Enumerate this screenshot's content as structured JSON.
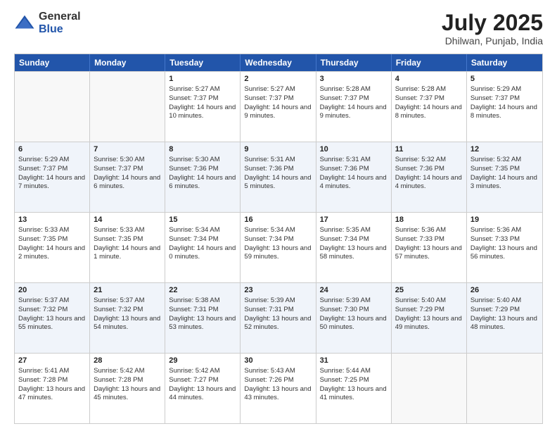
{
  "logo": {
    "general": "General",
    "blue": "Blue"
  },
  "header": {
    "month": "July 2025",
    "location": "Dhilwan, Punjab, India"
  },
  "weekdays": [
    "Sunday",
    "Monday",
    "Tuesday",
    "Wednesday",
    "Thursday",
    "Friday",
    "Saturday"
  ],
  "weeks": [
    [
      {
        "day": "",
        "sunrise": "",
        "sunset": "",
        "daylight": ""
      },
      {
        "day": "",
        "sunrise": "",
        "sunset": "",
        "daylight": ""
      },
      {
        "day": "1",
        "sunrise": "Sunrise: 5:27 AM",
        "sunset": "Sunset: 7:37 PM",
        "daylight": "Daylight: 14 hours and 10 minutes."
      },
      {
        "day": "2",
        "sunrise": "Sunrise: 5:27 AM",
        "sunset": "Sunset: 7:37 PM",
        "daylight": "Daylight: 14 hours and 9 minutes."
      },
      {
        "day": "3",
        "sunrise": "Sunrise: 5:28 AM",
        "sunset": "Sunset: 7:37 PM",
        "daylight": "Daylight: 14 hours and 9 minutes."
      },
      {
        "day": "4",
        "sunrise": "Sunrise: 5:28 AM",
        "sunset": "Sunset: 7:37 PM",
        "daylight": "Daylight: 14 hours and 8 minutes."
      },
      {
        "day": "5",
        "sunrise": "Sunrise: 5:29 AM",
        "sunset": "Sunset: 7:37 PM",
        "daylight": "Daylight: 14 hours and 8 minutes."
      }
    ],
    [
      {
        "day": "6",
        "sunrise": "Sunrise: 5:29 AM",
        "sunset": "Sunset: 7:37 PM",
        "daylight": "Daylight: 14 hours and 7 minutes."
      },
      {
        "day": "7",
        "sunrise": "Sunrise: 5:30 AM",
        "sunset": "Sunset: 7:37 PM",
        "daylight": "Daylight: 14 hours and 6 minutes."
      },
      {
        "day": "8",
        "sunrise": "Sunrise: 5:30 AM",
        "sunset": "Sunset: 7:36 PM",
        "daylight": "Daylight: 14 hours and 6 minutes."
      },
      {
        "day": "9",
        "sunrise": "Sunrise: 5:31 AM",
        "sunset": "Sunset: 7:36 PM",
        "daylight": "Daylight: 14 hours and 5 minutes."
      },
      {
        "day": "10",
        "sunrise": "Sunrise: 5:31 AM",
        "sunset": "Sunset: 7:36 PM",
        "daylight": "Daylight: 14 hours and 4 minutes."
      },
      {
        "day": "11",
        "sunrise": "Sunrise: 5:32 AM",
        "sunset": "Sunset: 7:36 PM",
        "daylight": "Daylight: 14 hours and 4 minutes."
      },
      {
        "day": "12",
        "sunrise": "Sunrise: 5:32 AM",
        "sunset": "Sunset: 7:35 PM",
        "daylight": "Daylight: 14 hours and 3 minutes."
      }
    ],
    [
      {
        "day": "13",
        "sunrise": "Sunrise: 5:33 AM",
        "sunset": "Sunset: 7:35 PM",
        "daylight": "Daylight: 14 hours and 2 minutes."
      },
      {
        "day": "14",
        "sunrise": "Sunrise: 5:33 AM",
        "sunset": "Sunset: 7:35 PM",
        "daylight": "Daylight: 14 hours and 1 minute."
      },
      {
        "day": "15",
        "sunrise": "Sunrise: 5:34 AM",
        "sunset": "Sunset: 7:34 PM",
        "daylight": "Daylight: 14 hours and 0 minutes."
      },
      {
        "day": "16",
        "sunrise": "Sunrise: 5:34 AM",
        "sunset": "Sunset: 7:34 PM",
        "daylight": "Daylight: 13 hours and 59 minutes."
      },
      {
        "day": "17",
        "sunrise": "Sunrise: 5:35 AM",
        "sunset": "Sunset: 7:34 PM",
        "daylight": "Daylight: 13 hours and 58 minutes."
      },
      {
        "day": "18",
        "sunrise": "Sunrise: 5:36 AM",
        "sunset": "Sunset: 7:33 PM",
        "daylight": "Daylight: 13 hours and 57 minutes."
      },
      {
        "day": "19",
        "sunrise": "Sunrise: 5:36 AM",
        "sunset": "Sunset: 7:33 PM",
        "daylight": "Daylight: 13 hours and 56 minutes."
      }
    ],
    [
      {
        "day": "20",
        "sunrise": "Sunrise: 5:37 AM",
        "sunset": "Sunset: 7:32 PM",
        "daylight": "Daylight: 13 hours and 55 minutes."
      },
      {
        "day": "21",
        "sunrise": "Sunrise: 5:37 AM",
        "sunset": "Sunset: 7:32 PM",
        "daylight": "Daylight: 13 hours and 54 minutes."
      },
      {
        "day": "22",
        "sunrise": "Sunrise: 5:38 AM",
        "sunset": "Sunset: 7:31 PM",
        "daylight": "Daylight: 13 hours and 53 minutes."
      },
      {
        "day": "23",
        "sunrise": "Sunrise: 5:39 AM",
        "sunset": "Sunset: 7:31 PM",
        "daylight": "Daylight: 13 hours and 52 minutes."
      },
      {
        "day": "24",
        "sunrise": "Sunrise: 5:39 AM",
        "sunset": "Sunset: 7:30 PM",
        "daylight": "Daylight: 13 hours and 50 minutes."
      },
      {
        "day": "25",
        "sunrise": "Sunrise: 5:40 AM",
        "sunset": "Sunset: 7:29 PM",
        "daylight": "Daylight: 13 hours and 49 minutes."
      },
      {
        "day": "26",
        "sunrise": "Sunrise: 5:40 AM",
        "sunset": "Sunset: 7:29 PM",
        "daylight": "Daylight: 13 hours and 48 minutes."
      }
    ],
    [
      {
        "day": "27",
        "sunrise": "Sunrise: 5:41 AM",
        "sunset": "Sunset: 7:28 PM",
        "daylight": "Daylight: 13 hours and 47 minutes."
      },
      {
        "day": "28",
        "sunrise": "Sunrise: 5:42 AM",
        "sunset": "Sunset: 7:28 PM",
        "daylight": "Daylight: 13 hours and 45 minutes."
      },
      {
        "day": "29",
        "sunrise": "Sunrise: 5:42 AM",
        "sunset": "Sunset: 7:27 PM",
        "daylight": "Daylight: 13 hours and 44 minutes."
      },
      {
        "day": "30",
        "sunrise": "Sunrise: 5:43 AM",
        "sunset": "Sunset: 7:26 PM",
        "daylight": "Daylight: 13 hours and 43 minutes."
      },
      {
        "day": "31",
        "sunrise": "Sunrise: 5:44 AM",
        "sunset": "Sunset: 7:25 PM",
        "daylight": "Daylight: 13 hours and 41 minutes."
      },
      {
        "day": "",
        "sunrise": "",
        "sunset": "",
        "daylight": ""
      },
      {
        "day": "",
        "sunrise": "",
        "sunset": "",
        "daylight": ""
      }
    ]
  ]
}
